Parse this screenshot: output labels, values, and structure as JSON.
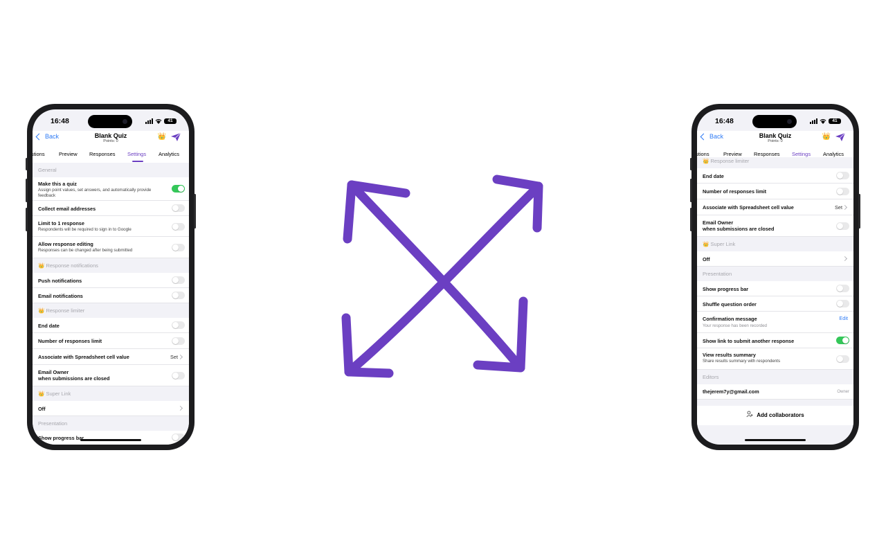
{
  "status": {
    "time": "16:48",
    "battery": "41"
  },
  "header": {
    "back_label": "Back",
    "title": "Blank Quiz",
    "subtitle": "Points: 0",
    "crown": "👑"
  },
  "tabs": [
    "Questions",
    "Preview",
    "Responses",
    "Settings",
    "Analytics"
  ],
  "tabs_visible": [
    "stions",
    "Preview",
    "Responses",
    "Settings",
    "Analytics"
  ],
  "active_tab": "Settings",
  "colors": {
    "accent": "#6b3fc2",
    "link": "#2f7bf5",
    "toggle_on": "#34c759",
    "arrow": "#6b3fc2"
  },
  "left_screen": {
    "sections": [
      {
        "title": "General",
        "rows": [
          {
            "label": "Make this a quiz",
            "sub": "Assign point values, set answers, and automatically provide feedback",
            "toggle": true
          },
          {
            "label": "Collect email addresses",
            "toggle": false
          },
          {
            "label": "Limit to 1 response",
            "sub": "Respondents will be required to sign in to Google",
            "toggle": false
          },
          {
            "label": "Allow response editing",
            "sub": "Responses can be changed after being submitted",
            "toggle": false
          }
        ]
      },
      {
        "title": "Response notifications",
        "crown": true,
        "rows": [
          {
            "label": "Push notifications",
            "toggle": false
          },
          {
            "label": "Email notifications",
            "toggle": false
          }
        ]
      },
      {
        "title": "Response limiter",
        "crown": true,
        "rows": [
          {
            "label": "End date",
            "toggle": false
          },
          {
            "label": "Number of responses limit",
            "toggle": false
          },
          {
            "label": "Associate with Spreadsheet cell value",
            "value": "Set"
          },
          {
            "label": "Email Owner",
            "label2": "when submissions are closed",
            "toggle": false
          }
        ]
      },
      {
        "title": "Super Link",
        "crown": true,
        "rows": [
          {
            "label": "Off"
          }
        ]
      },
      {
        "title": "Presentation",
        "rows": [
          {
            "label": "Show progress bar",
            "toggle": false
          }
        ]
      }
    ]
  },
  "right_screen": {
    "sections": [
      {
        "title": "Response limiter",
        "crown": true,
        "rows": [
          {
            "label": "End date",
            "toggle": false
          },
          {
            "label": "Number of responses limit",
            "toggle": false
          },
          {
            "label": "Associate with Spreadsheet cell value",
            "value": "Set"
          },
          {
            "label": "Email Owner",
            "label2": "when submissions are closed",
            "toggle": false
          }
        ]
      },
      {
        "title": "Super Link",
        "crown": true,
        "rows": [
          {
            "label": "Off"
          }
        ]
      },
      {
        "title": "Presentation",
        "rows": [
          {
            "label": "Show progress bar",
            "toggle": false
          },
          {
            "label": "Shuffle question order",
            "toggle": false
          },
          {
            "label": "Confirmation message",
            "sub": "Your response has been recorded",
            "link": "Edit"
          },
          {
            "label": "Show link to submit another response",
            "toggle": true
          },
          {
            "label": "View results summary",
            "sub": "Share results summary with respondents",
            "toggle": false
          }
        ]
      },
      {
        "title": "Editors",
        "rows": [
          {
            "label": "thejerem7y@gmail.com",
            "role": "Owner"
          }
        ]
      }
    ],
    "add_collaborators": "Add collaborators"
  },
  "center_icon": "expand-arrows-icon"
}
